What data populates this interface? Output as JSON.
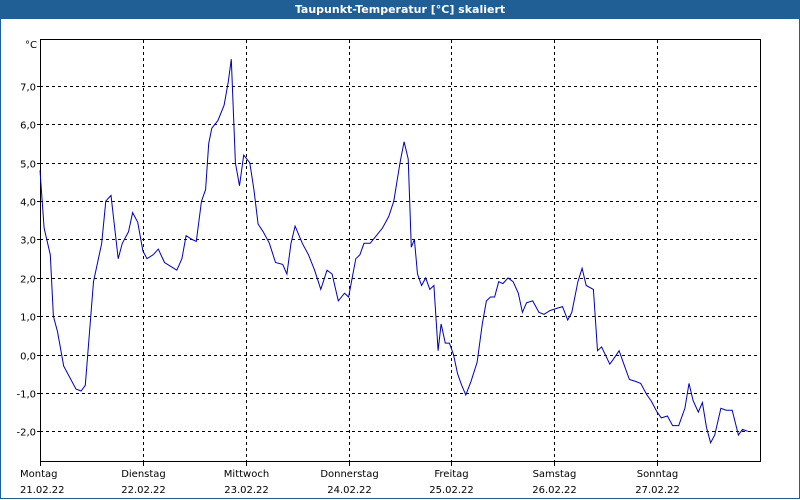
{
  "window": {
    "title": "Taupunkt-Temperatur [°C] skaliert"
  },
  "colors": {
    "title_bar": "#1f5f96",
    "line": "#0000b4",
    "grid": "#000000"
  },
  "chart_data": {
    "type": "line",
    "title": "Taupunkt-Temperatur [°C] skaliert",
    "unit_label": "°C",
    "ylim": [
      -2.8,
      8.2
    ],
    "y_ticks": [
      "7,0",
      "6,0",
      "5,0",
      "4,0",
      "3,0",
      "2,0",
      "1,0",
      "0,0",
      "-1,0",
      "-2,0"
    ],
    "y_tick_values": [
      7,
      6,
      5,
      4,
      3,
      2,
      1,
      0,
      -1,
      -2
    ],
    "xlim_days": [
      0,
      7
    ],
    "x_ticks": [
      {
        "day": "Montag",
        "date": "21.02.22"
      },
      {
        "day": "Dienstag",
        "date": "22.02.22"
      },
      {
        "day": "Mittwoch",
        "date": "23.02.22"
      },
      {
        "day": "Donnerstag",
        "date": "24.02.22"
      },
      {
        "day": "Freitag",
        "date": "25.02.22"
      },
      {
        "day": "Samstag",
        "date": "26.02.22"
      },
      {
        "day": "Sonntag",
        "date": "27.02.22"
      }
    ],
    "grid": true,
    "series": [
      {
        "values": [
          [
            0.0,
            4.8
          ],
          [
            0.04,
            3.3
          ],
          [
            0.1,
            2.6
          ],
          [
            0.13,
            1.0
          ],
          [
            0.17,
            0.6
          ],
          [
            0.23,
            -0.3
          ],
          [
            0.35,
            -0.9
          ],
          [
            0.4,
            -0.95
          ],
          [
            0.44,
            -0.8
          ],
          [
            0.52,
            1.9
          ],
          [
            0.6,
            2.9
          ],
          [
            0.64,
            4.0
          ],
          [
            0.69,
            4.15
          ],
          [
            0.76,
            2.5
          ],
          [
            0.8,
            2.9
          ],
          [
            0.86,
            3.2
          ],
          [
            0.9,
            3.7
          ],
          [
            0.95,
            3.45
          ],
          [
            1.0,
            2.7
          ],
          [
            1.04,
            2.5
          ],
          [
            1.1,
            2.6
          ],
          [
            1.15,
            2.75
          ],
          [
            1.21,
            2.4
          ],
          [
            1.27,
            2.3
          ],
          [
            1.33,
            2.2
          ],
          [
            1.38,
            2.5
          ],
          [
            1.42,
            3.1
          ],
          [
            1.48,
            3.0
          ],
          [
            1.52,
            2.95
          ],
          [
            1.57,
            4.0
          ],
          [
            1.61,
            4.3
          ],
          [
            1.64,
            5.5
          ],
          [
            1.67,
            5.9
          ],
          [
            1.73,
            6.1
          ],
          [
            1.79,
            6.5
          ],
          [
            1.83,
            7.1
          ],
          [
            1.86,
            7.7
          ],
          [
            1.9,
            5.0
          ],
          [
            1.94,
            4.4
          ],
          [
            1.98,
            5.2
          ],
          [
            2.04,
            5.0
          ],
          [
            2.08,
            4.3
          ],
          [
            2.12,
            3.4
          ],
          [
            2.17,
            3.2
          ],
          [
            2.23,
            2.9
          ],
          [
            2.29,
            2.4
          ],
          [
            2.36,
            2.35
          ],
          [
            2.4,
            2.1
          ],
          [
            2.44,
            2.9
          ],
          [
            2.48,
            3.35
          ],
          [
            2.55,
            2.9
          ],
          [
            2.61,
            2.6
          ],
          [
            2.67,
            2.2
          ],
          [
            2.73,
            1.7
          ],
          [
            2.79,
            2.2
          ],
          [
            2.84,
            2.1
          ],
          [
            2.9,
            1.4
          ],
          [
            2.96,
            1.6
          ],
          [
            3.0,
            1.5
          ],
          [
            3.07,
            2.5
          ],
          [
            3.11,
            2.6
          ],
          [
            3.15,
            2.9
          ],
          [
            3.21,
            2.9
          ],
          [
            3.27,
            3.1
          ],
          [
            3.33,
            3.3
          ],
          [
            3.39,
            3.6
          ],
          [
            3.44,
            4.0
          ],
          [
            3.5,
            5.0
          ],
          [
            3.54,
            5.55
          ],
          [
            3.58,
            5.1
          ],
          [
            3.61,
            2.8
          ],
          [
            3.64,
            3.0
          ],
          [
            3.67,
            2.1
          ],
          [
            3.71,
            1.8
          ],
          [
            3.75,
            2.0
          ],
          [
            3.79,
            1.7
          ],
          [
            3.83,
            1.8
          ],
          [
            3.87,
            0.1
          ],
          [
            3.9,
            0.8
          ],
          [
            3.94,
            0.3
          ],
          [
            3.98,
            0.3
          ],
          [
            4.02,
            0.0
          ],
          [
            4.06,
            -0.5
          ],
          [
            4.1,
            -0.8
          ],
          [
            4.14,
            -1.05
          ],
          [
            4.19,
            -0.7
          ],
          [
            4.25,
            -0.2
          ],
          [
            4.3,
            0.8
          ],
          [
            4.34,
            1.4
          ],
          [
            4.38,
            1.5
          ],
          [
            4.42,
            1.5
          ],
          [
            4.46,
            1.9
          ],
          [
            4.5,
            1.85
          ],
          [
            4.55,
            2.0
          ],
          [
            4.6,
            1.9
          ],
          [
            4.65,
            1.6
          ],
          [
            4.69,
            1.1
          ],
          [
            4.73,
            1.35
          ],
          [
            4.79,
            1.4
          ],
          [
            4.85,
            1.1
          ],
          [
            4.9,
            1.05
          ],
          [
            4.96,
            1.15
          ],
          [
            5.02,
            1.2
          ],
          [
            5.08,
            1.25
          ],
          [
            5.13,
            0.9
          ],
          [
            5.17,
            1.1
          ],
          [
            5.23,
            1.9
          ],
          [
            5.27,
            2.25
          ],
          [
            5.31,
            1.8
          ],
          [
            5.38,
            1.7
          ],
          [
            5.42,
            0.1
          ],
          [
            5.46,
            0.2
          ],
          [
            5.54,
            -0.25
          ],
          [
            5.58,
            -0.1
          ],
          [
            5.63,
            0.1
          ],
          [
            5.67,
            -0.2
          ],
          [
            5.73,
            -0.65
          ],
          [
            5.79,
            -0.7
          ],
          [
            5.84,
            -0.75
          ],
          [
            5.9,
            -1.05
          ],
          [
            5.94,
            -1.2
          ],
          [
            6.0,
            -1.5
          ],
          [
            6.04,
            -1.65
          ],
          [
            6.1,
            -1.6
          ],
          [
            6.15,
            -1.85
          ],
          [
            6.21,
            -1.85
          ],
          [
            6.27,
            -1.4
          ],
          [
            6.31,
            -0.75
          ],
          [
            6.35,
            -1.2
          ],
          [
            6.4,
            -1.5
          ],
          [
            6.44,
            -1.25
          ],
          [
            6.48,
            -1.9
          ],
          [
            6.52,
            -2.3
          ],
          [
            6.56,
            -2.1
          ],
          [
            6.62,
            -1.4
          ],
          [
            6.67,
            -1.45
          ],
          [
            6.73,
            -1.45
          ],
          [
            6.79,
            -2.1
          ],
          [
            6.83,
            -1.95
          ],
          [
            6.88,
            -2.0
          ]
        ]
      }
    ]
  }
}
